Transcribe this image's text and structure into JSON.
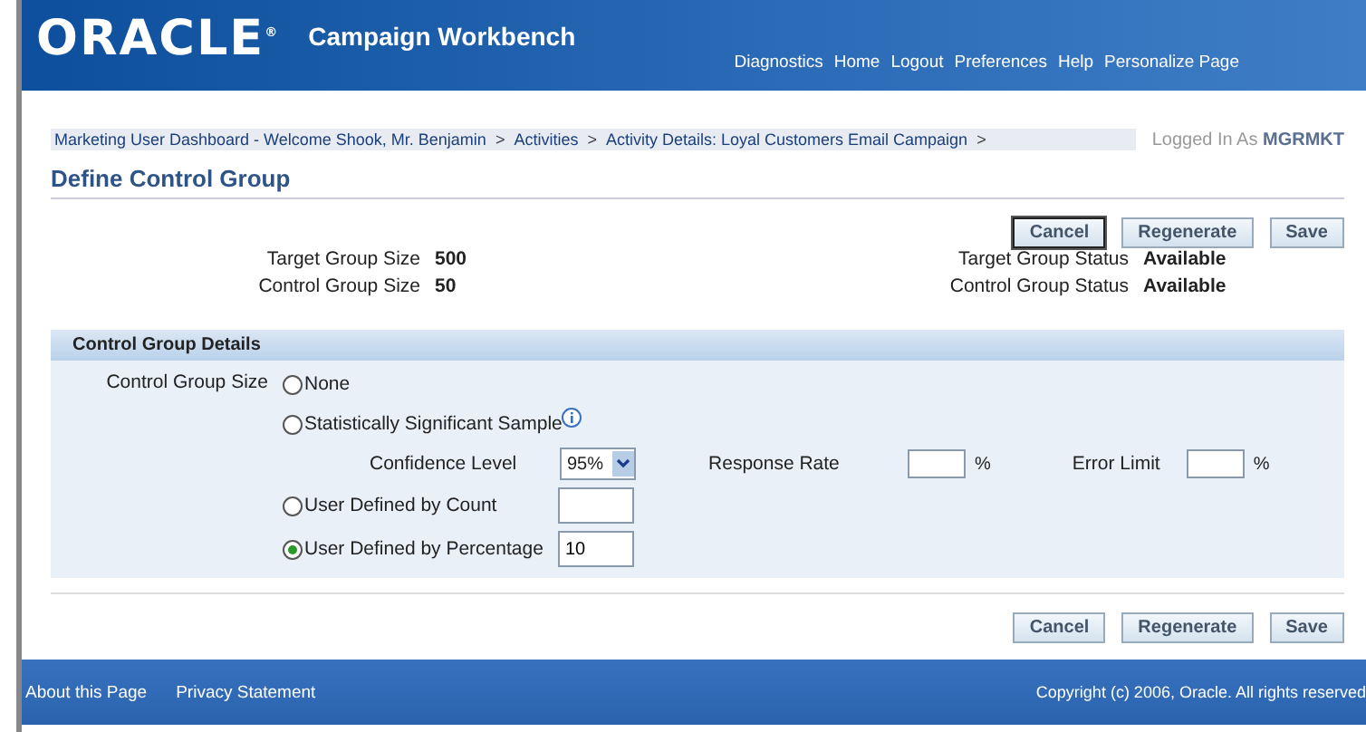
{
  "header": {
    "logo": "ORACLE",
    "logo_mark": "®",
    "app_title": "Campaign Workbench",
    "global_links": [
      "Diagnostics",
      "Home",
      "Logout",
      "Preferences",
      "Help",
      "Personalize Page"
    ]
  },
  "breadcrumbs": [
    "Marketing User Dashboard - Welcome Shook, Mr. Benjamin",
    ">",
    "Activities",
    ">",
    "Activity Details: Loyal Customers Email Campaign",
    ">"
  ],
  "logged_in": {
    "label": "Logged In As",
    "user": "MGRMKT"
  },
  "page_title": "Define Control Group",
  "buttons": [
    {
      "label": "Cancel",
      "focused": true
    },
    {
      "label": "Regenerate",
      "focused": false
    },
    {
      "label": "Save",
      "focused": false
    }
  ],
  "summary": {
    "left": [
      {
        "label": "Target Group Size",
        "value": "500"
      },
      {
        "label": "Control Group Size",
        "value": "50"
      }
    ],
    "right": [
      {
        "label": "Target Group Status",
        "value": "Available"
      },
      {
        "label": "Control Group Status",
        "value": "Available"
      }
    ]
  },
  "section": {
    "title": "Control Group Details",
    "field_label": "Control Group Size",
    "options": [
      {
        "kind": "plain",
        "label": "None",
        "selected": false
      },
      {
        "kind": "sample",
        "label": "Statistically Significant Sample",
        "selected": false,
        "confidence_label": "Confidence Level",
        "confidence_value": "95%",
        "response_label": "Response Rate",
        "response_unit": "%",
        "error_label": "Error Limit",
        "error_unit": "%"
      },
      {
        "kind": "input",
        "label": "User Defined by Count",
        "selected": false
      },
      {
        "kind": "input",
        "label": "User Defined by Percentage",
        "selected": true,
        "value": "10"
      }
    ]
  },
  "bottom_buttons": [
    {
      "label": "Cancel",
      "focused": false
    },
    {
      "label": "Regenerate",
      "focused": false
    },
    {
      "label": "Save",
      "focused": false
    }
  ],
  "footer": {
    "links": [
      "About this Page",
      "Privacy Statement"
    ],
    "copyright": "Copyright (c) 2006, Oracle. All rights reserved"
  }
}
